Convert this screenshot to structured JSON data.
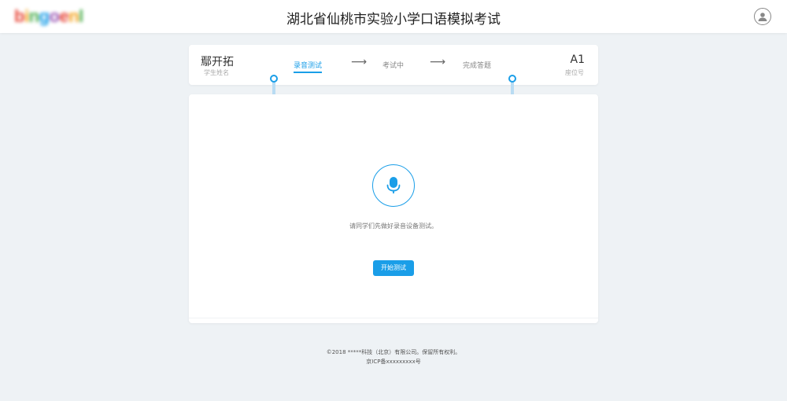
{
  "header": {
    "logo_text": "bingoenl",
    "logo_colors": [
      "#e84a3c",
      "#f5a623",
      "#4caf50",
      "#1a9ee8",
      "#9b59b6",
      "#e84a3c",
      "#f5a623",
      "#4caf50"
    ],
    "title": "湖北省仙桃市实验小学口语模拟考试",
    "avatar_icon": "user-avatar-icon"
  },
  "student": {
    "name": "鄢开拓",
    "name_label": "学生姓名",
    "seat": "A1",
    "seat_label": "座位号"
  },
  "steps": [
    {
      "label": "录音测试",
      "active": true
    },
    {
      "label": "考试中",
      "active": false
    },
    {
      "label": "完成答题",
      "active": false
    }
  ],
  "step_arrow": "⟶",
  "test": {
    "icon": "microphone-icon",
    "hint": "请同学们先做好录音设备测试。",
    "start_button": "开始测试"
  },
  "footer": {
    "copyright": "©2018 *****科技（北京）有限公司。保留所有权利。",
    "icp": "京ICP备xxxxxxxxx号"
  },
  "colors": {
    "accent": "#1a9ee8",
    "background": "#eef2f5"
  }
}
